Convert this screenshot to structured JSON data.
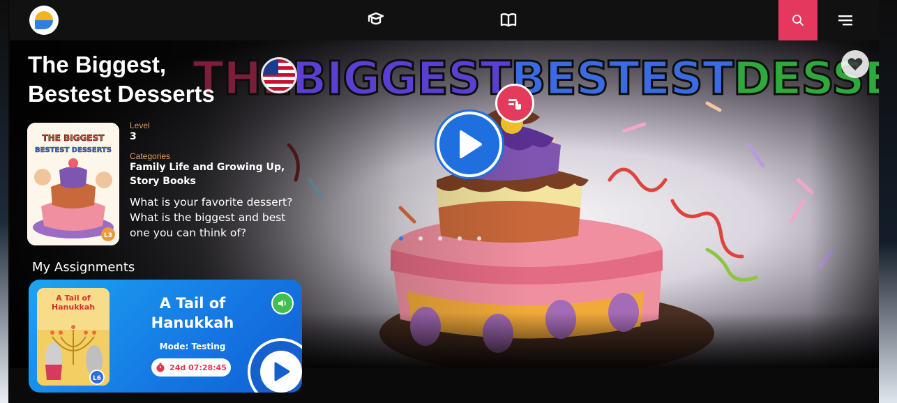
{
  "header": {
    "logo_icon": "bird-logo-icon",
    "nav": [
      {
        "id": "learn",
        "icon": "graduation-cap-icon"
      },
      {
        "id": "library",
        "icon": "open-book-icon"
      }
    ],
    "search_icon": "search-icon",
    "menu_icon": "hamburger-menu-icon",
    "search_color": "#e5385e"
  },
  "hero": {
    "banner_title": {
      "part1": "THE ",
      "part2": "BIGGEST ",
      "part3": "BESTEST ",
      "part4": "DESSERTS"
    },
    "language_flag": "us-flag-icon",
    "favorite_icon": "heart-icon",
    "interactive_icon": "tap-hand-icon",
    "play_icon": "play-icon",
    "carousel": {
      "count": 5,
      "active_index": 0
    }
  },
  "book": {
    "title_line1": "The Biggest,",
    "title_line2": "Bestest Desserts",
    "cover_title_line1": "THE BIGGEST",
    "cover_title_line2": "BESTEST DESSERTS",
    "cover_badge": "L3",
    "level_label": "Level",
    "level_value": "3",
    "categories_label": "Categories",
    "categories_line1": "Family Life and Growing Up,",
    "categories_line2": "Story Books",
    "description_line1": "What is your favorite dessert?",
    "description_line2": "What is the biggest and best",
    "description_line3": "one you can think of?"
  },
  "assignments": {
    "heading": "My Assignments",
    "items": [
      {
        "title_line1": "A Tail of",
        "title_line2": "Hanukkah",
        "cover_title_line1": "A Tail of",
        "cover_title_line2": "Hanukkah",
        "cover_badge": "L6",
        "mode": "Mode: Testing",
        "timer": "24d 07:28:45",
        "audio_icon": "audio-icon",
        "play_icon": "play-icon"
      }
    ]
  }
}
